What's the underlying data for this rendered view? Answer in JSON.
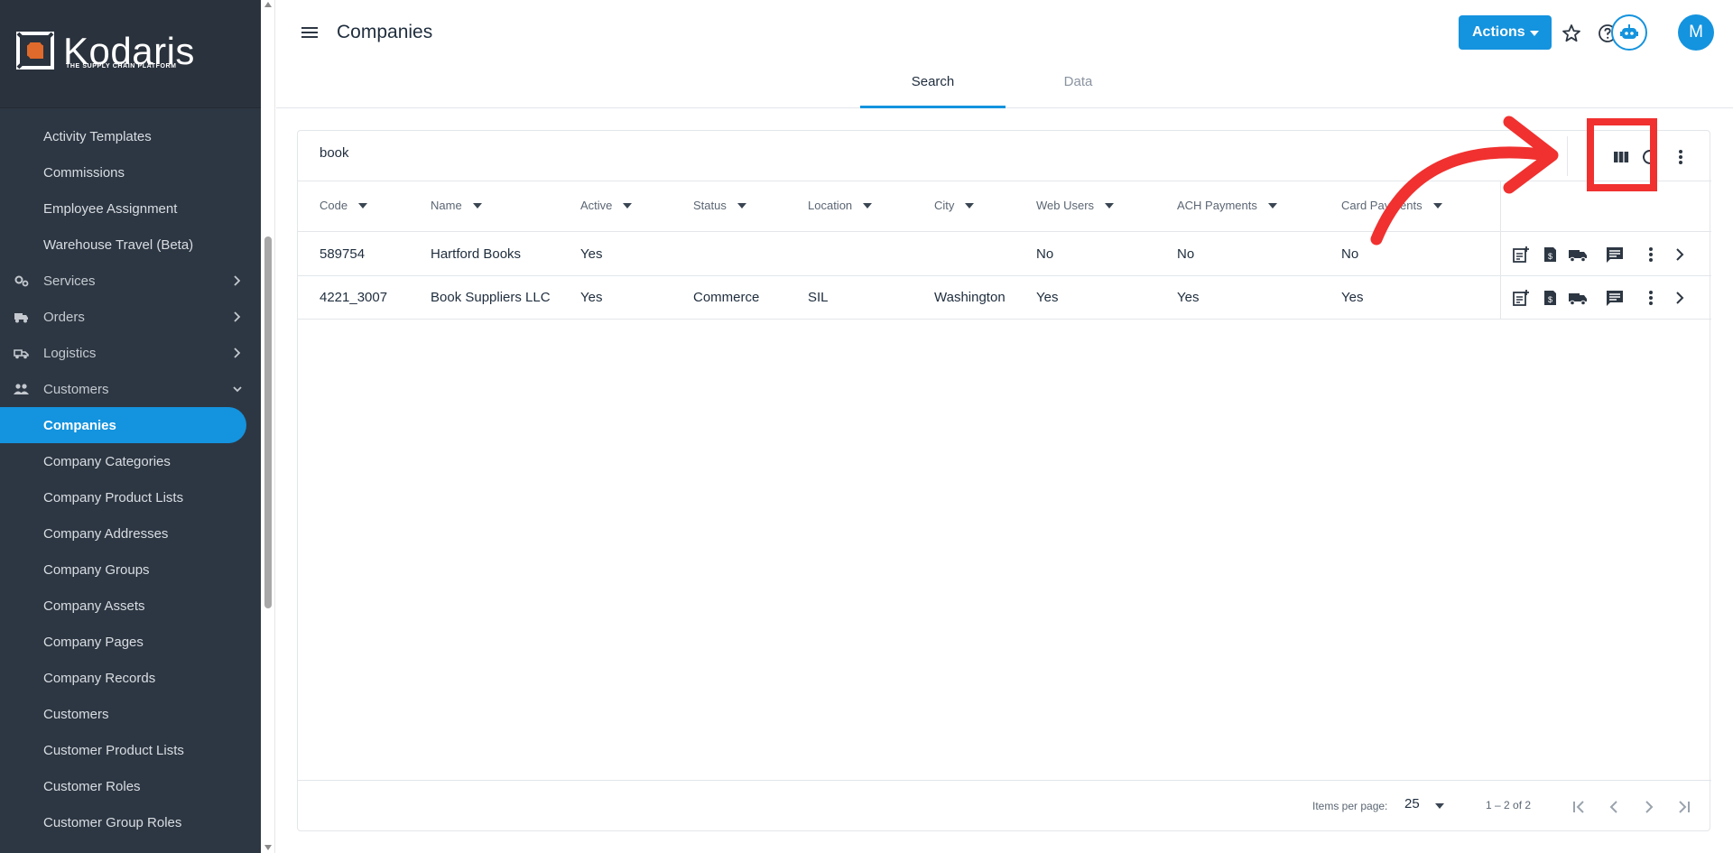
{
  "app": {
    "brand": "Kodaris",
    "tagline": "THE SUPPLY CHAIN PLATFORM",
    "accent_color": "#1493de",
    "annotation_color": "#f0312f"
  },
  "sidebar": {
    "items": [
      {
        "label": "Activity Templates"
      },
      {
        "label": "Commissions"
      },
      {
        "label": "Employee Assignment"
      },
      {
        "label": "Warehouse Travel (Beta)"
      },
      {
        "label": "Services",
        "icon": "gears-icon"
      },
      {
        "label": "Orders",
        "icon": "truck-icon"
      },
      {
        "label": "Logistics",
        "icon": "delivery-van-icon"
      },
      {
        "label": "Customers",
        "icon": "people-icon"
      },
      {
        "label": "Companies"
      },
      {
        "label": "Company Categories"
      },
      {
        "label": "Company Product Lists"
      },
      {
        "label": "Company Addresses"
      },
      {
        "label": "Company Groups"
      },
      {
        "label": "Company Assets"
      },
      {
        "label": "Company Pages"
      },
      {
        "label": "Company Records"
      },
      {
        "label": "Customers"
      },
      {
        "label": "Customer Product Lists"
      },
      {
        "label": "Customer Roles"
      },
      {
        "label": "Customer Group Roles"
      }
    ]
  },
  "header": {
    "title": "Companies",
    "actions_label": "Actions",
    "avatar_initial": "M",
    "tabs": [
      {
        "label": "Search"
      },
      {
        "label": "Data"
      }
    ]
  },
  "search": {
    "query": "book"
  },
  "table": {
    "columns": [
      "Code",
      "Name",
      "Active",
      "Status",
      "Location",
      "City",
      "Web Users",
      "ACH Payments",
      "Card Payments"
    ],
    "rows": [
      {
        "code": "589754",
        "name": "Hartford Books",
        "active": "Yes",
        "status": "",
        "location": "",
        "city": "",
        "web_users": "No",
        "ach_payments": "No",
        "card_payments": "No"
      },
      {
        "code": "4221_3007",
        "name": "Book Suppliers LLC",
        "active": "Yes",
        "status": "Commerce",
        "location": "SIL",
        "city": "Washington",
        "web_users": "Yes",
        "ach_payments": "Yes",
        "card_payments": "Yes"
      }
    ]
  },
  "paginator": {
    "items_per_page_label": "Items per page:",
    "page_size": "25",
    "range": "1 – 2 of 2"
  }
}
